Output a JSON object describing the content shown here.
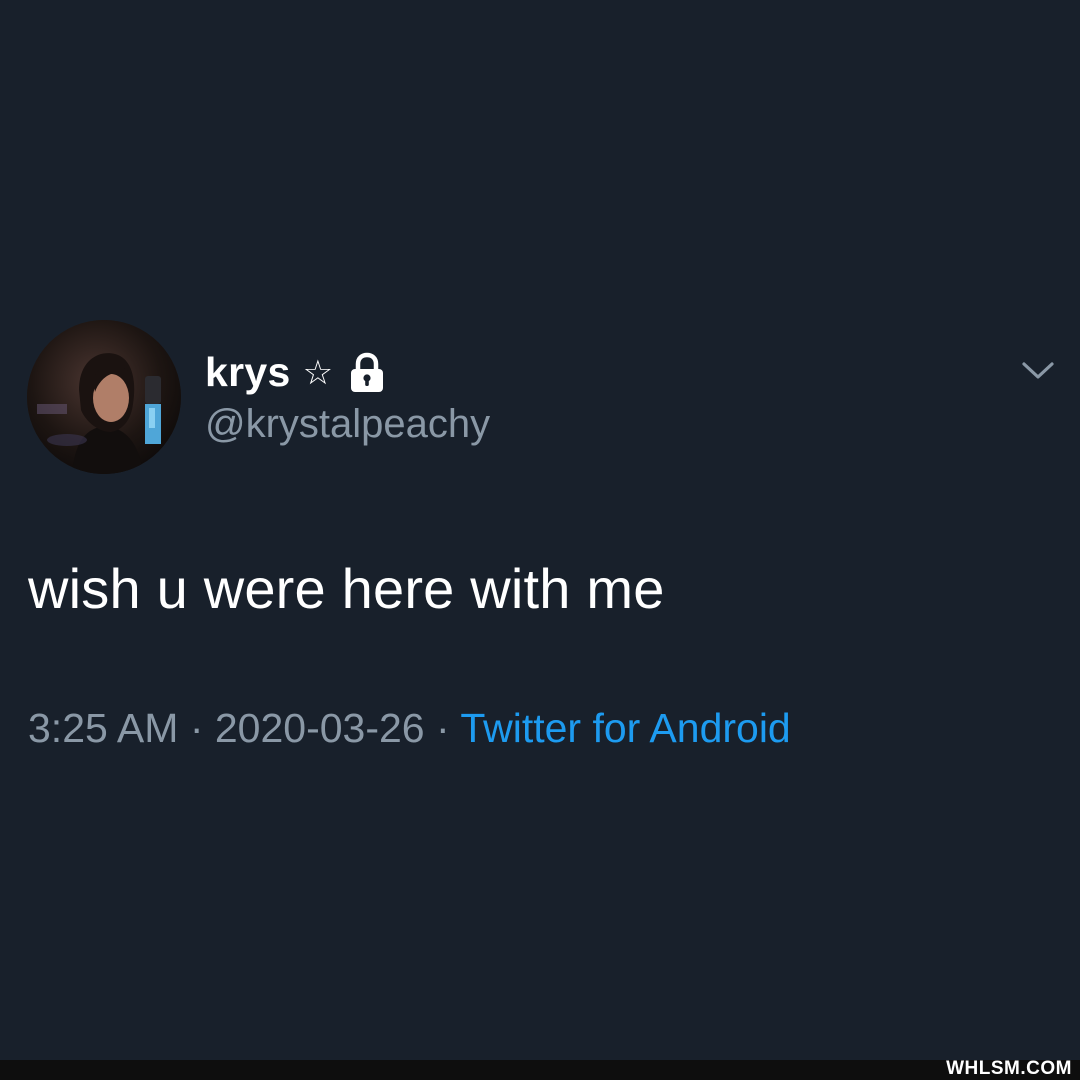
{
  "tweet": {
    "display_name": "krys",
    "name_emoji": "☆",
    "protected_icon": "lock-icon",
    "handle": "@krystalpeachy",
    "text": "wish u were here with me",
    "time": "3:25 AM",
    "separator": " · ",
    "date": "2020-03-26",
    "source": "Twitter for Android",
    "menu_icon": "chevron-down-icon",
    "avatar_icon": "avatar-photo"
  },
  "colors": {
    "background": "#18202b",
    "primary_text": "#ffffff",
    "secondary_text": "#8a98a6",
    "link": "#1d9bf0"
  },
  "watermark": {
    "text": "WHLSM.COM"
  }
}
